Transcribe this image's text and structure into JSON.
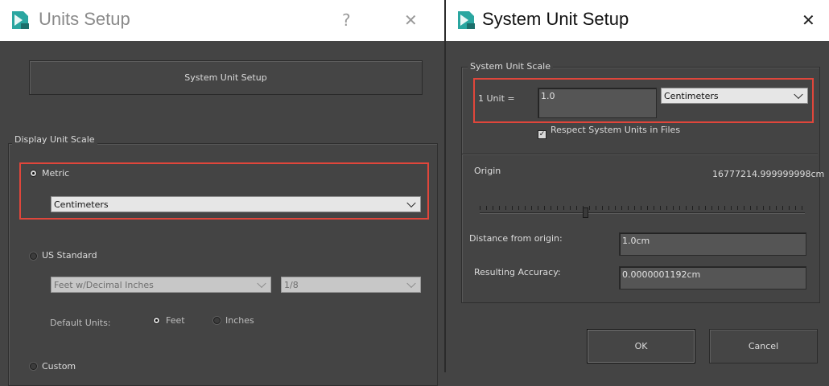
{
  "units_setup": {
    "title": "Units Setup",
    "help_glyph": "?",
    "close_glyph": "✕",
    "system_unit_setup_button": "System Unit Setup",
    "display_unit_scale": {
      "legend": "Display Unit Scale",
      "metric_label": "Metric",
      "metric_selected": true,
      "metric_value": "Centimeters",
      "us_standard_label": "US Standard",
      "us_standard_value": "Feet w/Decimal Inches",
      "us_standard_fraction": "1/8",
      "default_units_label": "Default Units:",
      "feet_label": "Feet",
      "inches_label": "Inches",
      "custom_label": "Custom"
    }
  },
  "system_unit_setup": {
    "title": "System Unit Setup",
    "close_glyph": "✕",
    "scale_legend": "System Unit Scale",
    "unit_label": "1 Unit =",
    "unit_value": "1.0",
    "unit_type": "Centimeters",
    "respect_label": "Respect System Units in Files",
    "respect_checked": true,
    "origin_label": "Origin",
    "origin_value": "16777214.999999998cm",
    "distance_label": "Distance from origin:",
    "distance_value": "1.0cm",
    "accuracy_label": "Resulting Accuracy:",
    "accuracy_value": "0.0000001192cm",
    "ok_label": "OK",
    "cancel_label": "Cancel"
  },
  "colors": {
    "panel_bg": "#444444",
    "titlebar_bg": "#ffffff",
    "highlight": "#e0463b",
    "logo_teal": "#2aa6a0"
  },
  "icons": [
    "app-logo-icon",
    "help-icon",
    "close-icon",
    "chevron-down-icon",
    "checkmark-icon"
  ]
}
